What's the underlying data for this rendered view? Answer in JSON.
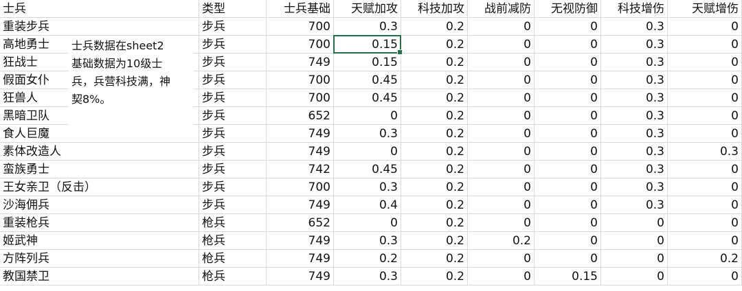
{
  "columns": [
    "士兵",
    "类型",
    "士兵基础",
    "天赋加攻",
    "科技加攻",
    "战前减防",
    "无视防御",
    "科技增伤",
    "天赋增伤"
  ],
  "rows": [
    [
      "重装步兵",
      "步兵",
      "700",
      "0.3",
      "0.2",
      "0",
      "0",
      "0.3",
      "0"
    ],
    [
      "高地勇士",
      "步兵",
      "700",
      "0.15",
      "0.2",
      "0",
      "0",
      "0.3",
      "0"
    ],
    [
      "狂战士",
      "步兵",
      "749",
      "0.15",
      "0.2",
      "0",
      "0",
      "0.3",
      "0"
    ],
    [
      "假面女仆",
      "步兵",
      "700",
      "0.45",
      "0.2",
      "0",
      "0",
      "0.3",
      "0"
    ],
    [
      "狂兽人",
      "步兵",
      "700",
      "0.45",
      "0.2",
      "0",
      "0",
      "0.3",
      "0"
    ],
    [
      "黑暗卫队",
      "步兵",
      "652",
      "0",
      "0.2",
      "0",
      "0",
      "0.3",
      "0"
    ],
    [
      "食人巨魔",
      "步兵",
      "749",
      "0.3",
      "0.2",
      "0",
      "0",
      "0.3",
      "0"
    ],
    [
      "素体改造人",
      "步兵",
      "749",
      "0",
      "0.2",
      "0",
      "0",
      "0.3",
      "0.3"
    ],
    [
      "蛮族勇士",
      "步兵",
      "742",
      "0.45",
      "0.2",
      "0",
      "0",
      "0.3",
      "0"
    ],
    [
      "王女亲卫（反击）",
      "步兵",
      "700",
      "0.3",
      "0.2",
      "0",
      "0",
      "0.3",
      "0"
    ],
    [
      "沙海佣兵",
      "步兵",
      "749",
      "0.4",
      "0.2",
      "0",
      "0",
      "0.3",
      "0"
    ],
    [
      "重装枪兵",
      "枪兵",
      "652",
      "0",
      "0.2",
      "0",
      "0",
      "0",
      "0"
    ],
    [
      "姬武神",
      "枪兵",
      "749",
      "0.3",
      "0.2",
      "0.2",
      "0",
      "0",
      "0"
    ],
    [
      "方阵列兵",
      "枪兵",
      "749",
      "0.2",
      "0.2",
      "0",
      "0",
      "0",
      "0.2"
    ],
    [
      "教国禁卫",
      "枪兵",
      "749",
      "0.3",
      "0.2",
      "0",
      "0.15",
      "0",
      "0"
    ]
  ],
  "note": {
    "lines": [
      "士兵数据在sheet2",
      "基础数据为10级士",
      "兵，兵营科技满，神",
      "契8%。"
    ]
  },
  "selected_cell": {
    "row": 1,
    "col": 3
  }
}
